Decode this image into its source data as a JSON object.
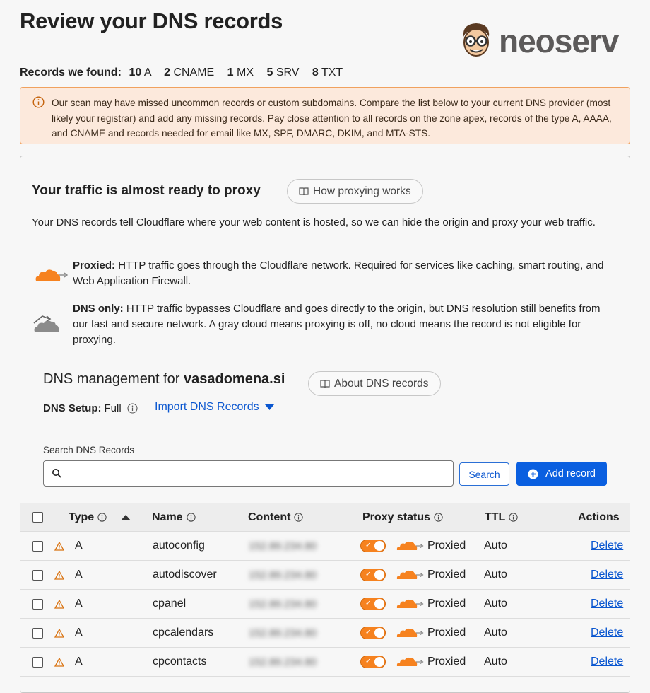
{
  "page": {
    "title": "Review your DNS records",
    "logo_text": "neoserv"
  },
  "summary": {
    "label": "Records we found:",
    "counts": [
      {
        "n": "10",
        "type": "A"
      },
      {
        "n": "2",
        "type": "CNAME"
      },
      {
        "n": "1",
        "type": "MX"
      },
      {
        "n": "5",
        "type": "SRV"
      },
      {
        "n": "8",
        "type": "TXT"
      }
    ]
  },
  "warning": {
    "text": "Our scan may have missed uncommon records or custom subdomains. Compare the list below to your current DNS provider (most likely your registrar) and add any missing records. Pay close attention to all records on the zone apex, records of the type A, AAAA, and CNAME and records needed for email like MX, SPF, DMARC, DKIM, and MTA-STS."
  },
  "proxy_section": {
    "heading": "Your traffic is almost ready to proxy",
    "how_button": "How proxying works",
    "intro": "Your DNS records tell Cloudflare where your web content is hosted, so we can hide the origin and proxy your web traffic.",
    "proxied_title": "Proxied:",
    "proxied_text": "HTTP traffic goes through the Cloudflare network. Required for services like caching, smart routing, and Web Application Firewall.",
    "dnsonly_title": "DNS only:",
    "dnsonly_text": "HTTP traffic bypasses Cloudflare and goes directly to the origin, but DNS resolution still benefits from our fast and secure network. A gray cloud means proxying is off, no cloud means the record is not eligible for proxying."
  },
  "dns_management": {
    "prefix": "DNS management for",
    "domain": "vasadomena.si",
    "about_button": "About DNS records",
    "setup_label": "DNS Setup:",
    "setup_value": "Full",
    "import_label": "Import DNS Records",
    "search_label": "Search DNS Records",
    "search_placeholder": "",
    "search_button": "Search",
    "add_button": "Add record"
  },
  "table": {
    "headers": {
      "type": "Type",
      "name": "Name",
      "content": "Content",
      "proxy": "Proxy status",
      "ttl": "TTL",
      "actions": "Actions"
    },
    "rows": [
      {
        "type": "A",
        "name": "autoconfig",
        "content": "152.89.234.80",
        "proxy": "Proxied",
        "ttl": "Auto",
        "action": "Delete"
      },
      {
        "type": "A",
        "name": "autodiscover",
        "content": "152.89.234.80",
        "proxy": "Proxied",
        "ttl": "Auto",
        "action": "Delete"
      },
      {
        "type": "A",
        "name": "cpanel",
        "content": "152.89.234.80",
        "proxy": "Proxied",
        "ttl": "Auto",
        "action": "Delete"
      },
      {
        "type": "A",
        "name": "cpcalendars",
        "content": "152.89.234.80",
        "proxy": "Proxied",
        "ttl": "Auto",
        "action": "Delete"
      },
      {
        "type": "A",
        "name": "cpcontacts",
        "content": "152.89.234.80",
        "proxy": "Proxied",
        "ttl": "Auto",
        "action": "Delete"
      }
    ]
  },
  "colors": {
    "accent_orange": "#f6821f",
    "link_blue": "#0b57d0",
    "warning_bg": "#fce9dc",
    "warning_border": "#f0a15e"
  }
}
